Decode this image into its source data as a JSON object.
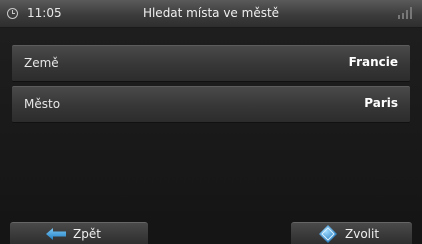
{
  "statusbar": {
    "time": "11:05",
    "title": "Hledat místa ve městě",
    "icons": [
      "clock-icon",
      "signal-icon"
    ]
  },
  "fields": [
    {
      "label": "Země",
      "value": "Francie"
    },
    {
      "label": "Město",
      "value": "Paris"
    }
  ],
  "footer": {
    "back_label": "Zpět",
    "back_icon": "back-arrow-icon",
    "ok_label": "Zvolit",
    "ok_icon": "confirm-icon"
  },
  "colors": {
    "accent": "#2e9be0"
  }
}
